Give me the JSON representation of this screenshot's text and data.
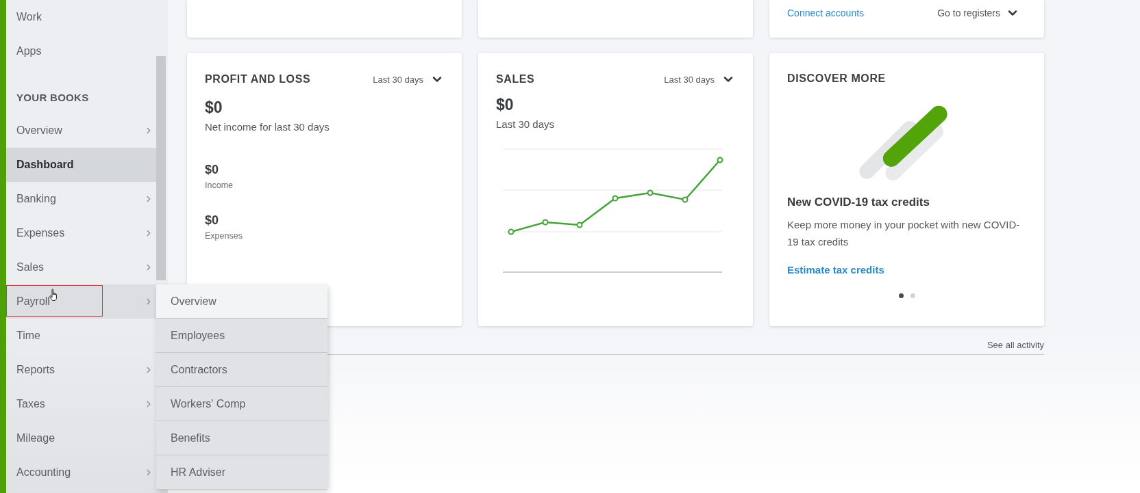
{
  "sidebar": {
    "items": [
      {
        "kind": "item",
        "label": "Work",
        "has_submenu": false,
        "selected": false,
        "expanded": false,
        "highlighted": false
      },
      {
        "kind": "item",
        "label": "Apps",
        "has_submenu": false,
        "selected": false,
        "expanded": false,
        "highlighted": false
      },
      {
        "kind": "heading",
        "label": "YOUR BOOKS"
      },
      {
        "kind": "item",
        "label": "Overview",
        "has_submenu": true,
        "selected": false,
        "expanded": false,
        "highlighted": false
      },
      {
        "kind": "item",
        "label": "Dashboard",
        "has_submenu": false,
        "selected": true,
        "expanded": false,
        "highlighted": false
      },
      {
        "kind": "item",
        "label": "Banking",
        "has_submenu": true,
        "selected": false,
        "expanded": false,
        "highlighted": false
      },
      {
        "kind": "item",
        "label": "Expenses",
        "has_submenu": true,
        "selected": false,
        "expanded": false,
        "highlighted": false
      },
      {
        "kind": "item",
        "label": "Sales",
        "has_submenu": true,
        "selected": false,
        "expanded": false,
        "highlighted": false
      },
      {
        "kind": "item",
        "label": "Payroll",
        "has_submenu": true,
        "selected": false,
        "expanded": true,
        "highlighted": true
      },
      {
        "kind": "item",
        "label": "Time",
        "has_submenu": false,
        "selected": false,
        "expanded": false,
        "highlighted": false
      },
      {
        "kind": "item",
        "label": "Reports",
        "has_submenu": true,
        "selected": false,
        "expanded": false,
        "highlighted": false
      },
      {
        "kind": "item",
        "label": "Taxes",
        "has_submenu": true,
        "selected": false,
        "expanded": false,
        "highlighted": false
      },
      {
        "kind": "item",
        "label": "Mileage",
        "has_submenu": false,
        "selected": false,
        "expanded": false,
        "highlighted": false
      },
      {
        "kind": "item",
        "label": "Accounting",
        "has_submenu": true,
        "selected": false,
        "expanded": false,
        "highlighted": false
      }
    ]
  },
  "flyout": {
    "items": [
      {
        "label": "Overview",
        "selected": true
      },
      {
        "label": "Employees",
        "selected": false
      },
      {
        "label": "Contractors",
        "selected": false
      },
      {
        "label": "Workers' Comp",
        "selected": false
      },
      {
        "label": "Benefits",
        "selected": false
      },
      {
        "label": "HR Adviser",
        "selected": false
      }
    ]
  },
  "bank_card": {
    "link": "Connect accounts",
    "menu": "Go to registers"
  },
  "profit_and_loss": {
    "title": "PROFIT AND LOSS",
    "period": "Last 30 days",
    "amount": "$0",
    "caption": "Net income for last 30 days",
    "metrics": [
      {
        "value": "$0",
        "label": "Income"
      },
      {
        "value": "$0",
        "label": "Expenses"
      }
    ]
  },
  "sales": {
    "title": "SALES",
    "period": "Last 30 days",
    "amount": "$0",
    "caption": "Last 30 days"
  },
  "discover": {
    "title": "DISCOVER MORE",
    "headline": "New COVID-19 tax credits",
    "body": "Keep more money in your pocket with new COVID-19 tax credits",
    "link": "Estimate tax credits",
    "pager": [
      {
        "selected": true
      },
      {
        "selected": false
      }
    ]
  },
  "activity_link": "See all activity"
}
